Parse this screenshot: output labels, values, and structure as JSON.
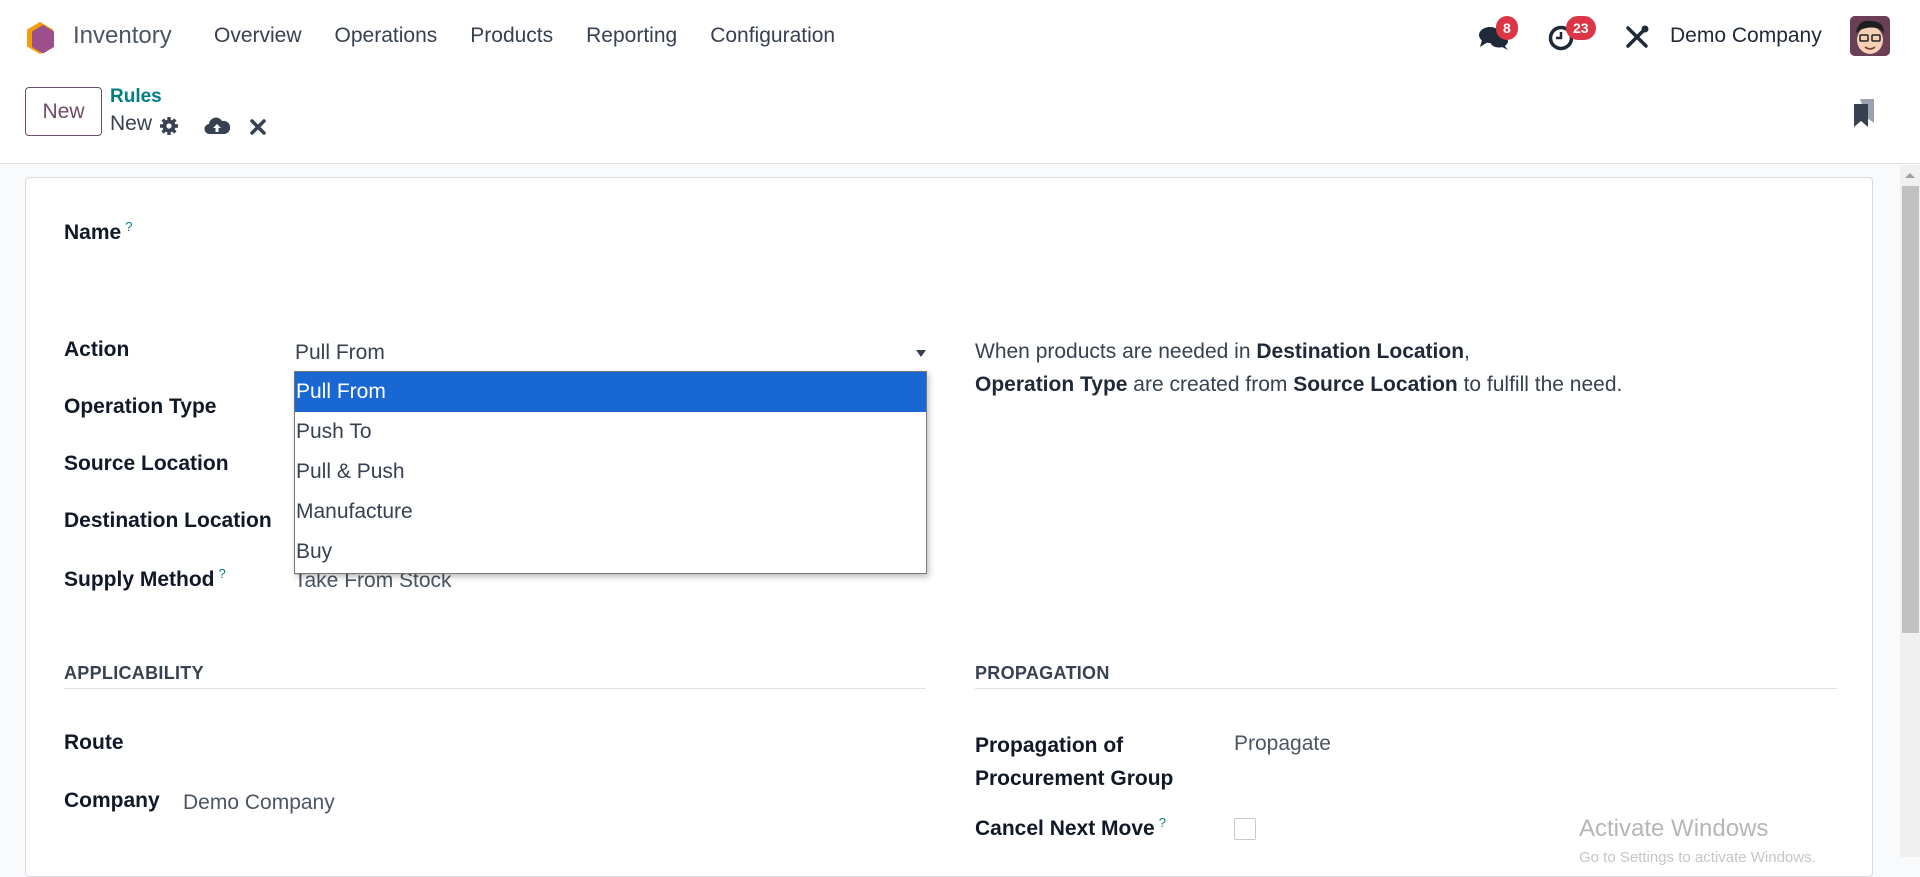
{
  "navbar": {
    "app_name": "Inventory",
    "menu": [
      "Overview",
      "Operations",
      "Products",
      "Reporting",
      "Configuration"
    ],
    "messages_count": "8",
    "activities_count": "23",
    "company": "Demo Company",
    "icons": {
      "app": "inventory-app-icon",
      "messages": "chat-bubbles-icon",
      "activities": "clock-icon",
      "debug": "tools-icon",
      "avatar": "user-avatar"
    }
  },
  "control_panel": {
    "new_button": "New",
    "breadcrumb_parent": "Rules",
    "record_name": "New",
    "icons": [
      "gear-icon",
      "cloud-upload-icon",
      "discard-icon",
      "bookmark-icon"
    ]
  },
  "form": {
    "name_label": "Name",
    "name_value": "",
    "action_label": "Action",
    "action_value": "Pull From",
    "action_options": [
      "Pull From",
      "Push To",
      "Pull & Push",
      "Manufacture",
      "Buy"
    ],
    "action_selected_index": 0,
    "operation_type_label": "Operation Type",
    "source_location_label": "Source Location",
    "destination_location_label": "Destination Location",
    "supply_method_label": "Supply Method",
    "supply_method_value": "Take From Stock",
    "help_text": {
      "p1": "When products are needed in ",
      "b1": "Destination Location",
      "p2": ",",
      "b2": "Operation Type",
      "p3": " are created from ",
      "b3": "Source Location",
      "p4": " to fulfill the need."
    },
    "help_marker": "?",
    "applicability": {
      "title": "APPLICABILITY",
      "route_label": "Route",
      "route_value": "",
      "company_label": "Company",
      "company_value": "Demo Company"
    },
    "propagation": {
      "title": "PROPAGATION",
      "group_label_line1": "Propagation of",
      "group_label_line2": "Procurement Group",
      "group_value": "Propagate",
      "cancel_next_move_label": "Cancel Next Move",
      "cancel_next_move_checked": false
    }
  },
  "overlay": {
    "watermark_title": "Activate Windows",
    "watermark_sub": "Go to Settings to activate Windows."
  }
}
